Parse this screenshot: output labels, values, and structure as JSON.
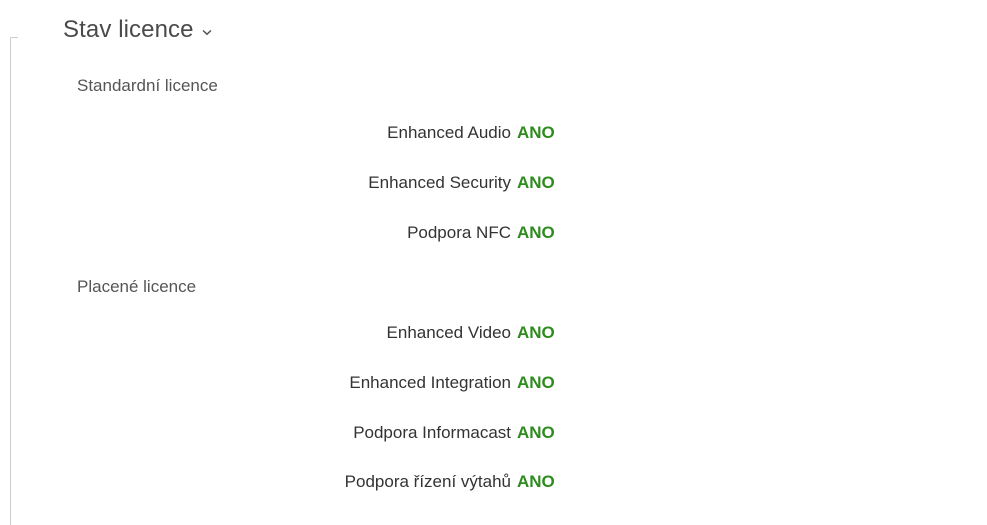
{
  "section": {
    "title": "Stav licence",
    "collapse_icon": "chevron-down-icon"
  },
  "groups": [
    {
      "title": "Standardní licence",
      "items": [
        {
          "label": "Enhanced Audio",
          "value": "ANO"
        },
        {
          "label": "Enhanced Security",
          "value": "ANO"
        },
        {
          "label": "Podpora NFC",
          "value": "ANO"
        }
      ]
    },
    {
      "title": "Placené licence",
      "items": [
        {
          "label": "Enhanced Video",
          "value": "ANO"
        },
        {
          "label": "Enhanced Integration",
          "value": "ANO"
        },
        {
          "label": "Podpora Informacast",
          "value": "ANO"
        },
        {
          "label": "Podpora řízení výtahů",
          "value": "ANO"
        }
      ]
    }
  ],
  "colors": {
    "status_yes": "#2e8b1f",
    "text": "#333333",
    "border": "#cfcfcf"
  }
}
